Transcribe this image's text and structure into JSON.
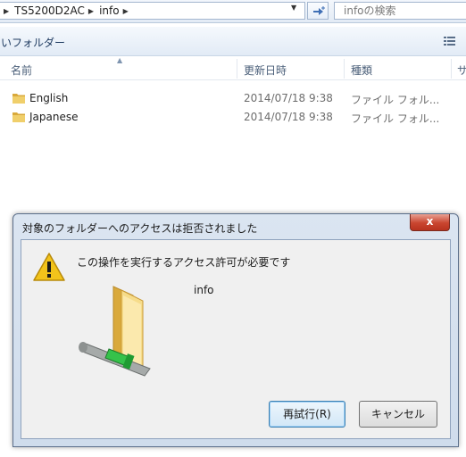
{
  "address_bar": {
    "crumbs": [
      "TS5200D2AC",
      "info"
    ],
    "search_placeholder": "infoの検索"
  },
  "toolbar": {
    "new_folder_label": "いフォルダー"
  },
  "columns": {
    "name": "名前",
    "date": "更新日時",
    "type": "種類",
    "size": "サ"
  },
  "files": [
    {
      "name": "English",
      "date": "2014/07/18 9:38",
      "type": "ファイル フォル..."
    },
    {
      "name": "Japanese",
      "date": "2014/07/18 9:38",
      "type": "ファイル フォル..."
    }
  ],
  "dialog": {
    "title": "対象のフォルダーへのアクセスは拒否されました",
    "close_label": "x",
    "message": "この操作を実行するアクセス許可が必要です",
    "item_name": "info",
    "retry_label": "再試行(R)",
    "cancel_label": "キャンセル"
  },
  "colors": {
    "folder": "#e8c25a",
    "close_button": "#c9452f",
    "warning": "#f2c31b"
  }
}
